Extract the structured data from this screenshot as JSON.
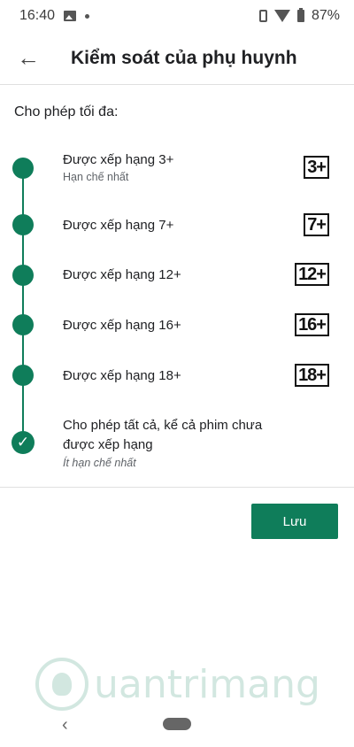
{
  "status_bar": {
    "time": "16:40",
    "battery": "87%",
    "icons": [
      "image-icon",
      "dot-icon",
      "vibrate-icon",
      "wifi-icon",
      "battery-icon"
    ]
  },
  "app_bar": {
    "back_icon": "arrow-left-icon",
    "title": "Kiểm soát của phụ huynh"
  },
  "section_label": "Cho phép tối đa:",
  "options": [
    {
      "title": "Được xếp hạng 3+",
      "subtitle": "Hạn chế nhất",
      "badge": "3+"
    },
    {
      "title": "Được xếp hạng 7+",
      "badge": "7+"
    },
    {
      "title": "Được xếp hạng 12+",
      "badge": "12+"
    },
    {
      "title": "Được xếp hạng 16+",
      "badge": "16+"
    },
    {
      "title": "Được xếp hạng 18+",
      "badge": "18+"
    },
    {
      "title_line1": "Cho phép tất cả, kể cả phim chưa",
      "title_line2": "được xếp hạng",
      "subtitle": "Ít hạn chế nhất",
      "selected": true
    }
  ],
  "save_button": "Lưu",
  "watermark": "uantrimang",
  "nav": {
    "back_icon": "nav-back-icon",
    "home_icon": "nav-home-pill"
  },
  "colors": {
    "accent": "#0f7d5a"
  }
}
